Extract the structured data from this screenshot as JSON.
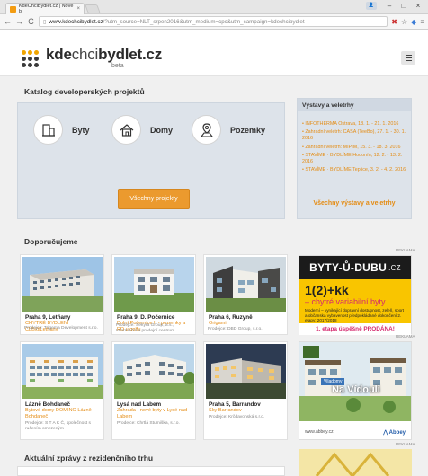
{
  "browser": {
    "tab_title": "KdeChciBydlet.cz | Nové b",
    "tab_close": "×",
    "url_host": "www.kdechcibydlet.cz",
    "url_rest": "/?utm_source=NLT_srpen2016&utm_medium=cpc&utm_campaign=kdechcibydlet",
    "back": "←",
    "forward": "→",
    "reload": "C",
    "page_icon": "▯",
    "minimize": "–",
    "maximize": "□",
    "close": "×"
  },
  "header": {
    "logo_kde": "kde",
    "logo_chci": "chci",
    "logo_bydlet": "bydlet",
    "logo_cz": ".cz",
    "logo_beta": "beta"
  },
  "catalog": {
    "title": "Katalog developerských projektů",
    "categories": [
      {
        "label": "Byty",
        "icon": "apartment-icon"
      },
      {
        "label": "Domy",
        "icon": "house-icon"
      },
      {
        "label": "Pozemky",
        "icon": "land-icon"
      }
    ],
    "all_button": "Všechny projekty"
  },
  "events": {
    "title": "Výstavy a veletrhy",
    "items": [
      "• INFOTHERMA Ostrava, 18. 1. - 21. 1. 2016",
      "• Zahradní veletrh: CASA (TeeBo), 27. 1. - 30. 1. 2016",
      "• Zahradní veletrh: MIPIM, 15. 3. - 18. 3. 2016",
      "• STAVÍME · BYDLÍME Hodonín, 12. 2. - 13. 2. 2016",
      "• STAVÍME · BYDLÍME Teplice, 3. 2. - 4. 2. 2016"
    ],
    "all_link": "Všechny výstavy a veletrhy"
  },
  "recommended": {
    "title": "Doporučujeme",
    "cards": [
      {
        "location": "Praha 9, Letňany",
        "project": "CHYTRÉ BYDLENÍ CLB@Letňany",
        "seller": "Prodejce: Trigema Development s.r.o."
      },
      {
        "location": "Praha 9, D. Počernice",
        "project": "Dolní Počernice II - pozemky a RD u golfu",
        "seller": "Prodejce: Sekyra Group, a.s., Informační a prodejní centrum"
      },
      {
        "location": "Praha 6, Ruzyně",
        "project": "Origami",
        "seller": "Prodejce: DBD Group, s.r.o."
      },
      {
        "location": "Lázně Bohdaneč",
        "project": "Bytové domy DOMINO Lázně Bohdaneč",
        "seller": "Prodejce: S T A K Č, společnost s ručením omezeným"
      },
      {
        "location": "Lysá nad Labem",
        "project": "Zahrada - nové byty v Lysé nad Labem",
        "seller": "Prodejce: Chrtlá Stumiška, s.r.o."
      },
      {
        "location": "Praha 5, Barrandov",
        "project": "Sky Barrandov",
        "seller": "Prodejce: Krčdavonská s.r.o."
      }
    ]
  },
  "ads": {
    "label": "REKLAMA",
    "ad1": {
      "brand": "BYTY-Ů-DUBU",
      "brand_cz": ".CZ",
      "headline": "1(2)+kk",
      "subline": "– chytré variabilní byty",
      "details": "Moderní – vynikající dopravní dostupnost, zeleň, sport a občanská vybavenost předpokládané dokončení 2. etapy: 2017/2018",
      "cta": "1. etapa úspěšně PRODÁNA!"
    },
    "ad2": {
      "badge": "Viladomy",
      "title": "Na Vídouli",
      "url": "www.abbey.cz",
      "brand": "Abbey"
    }
  },
  "news": {
    "title": "Aktuální zprávy z rezidenčního trhu"
  },
  "colors": {
    "accent": "#EB9A2E",
    "link": "#E48C14",
    "panel": "#DDE3EA"
  }
}
